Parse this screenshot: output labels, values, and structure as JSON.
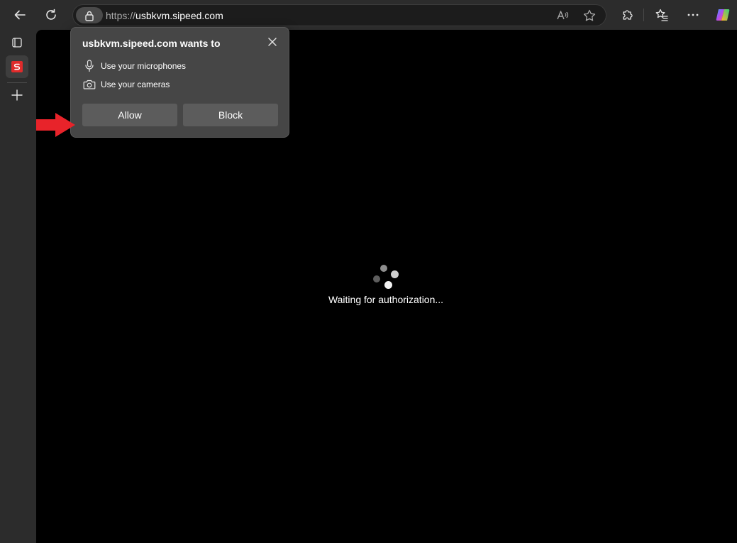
{
  "browser": {
    "url": {
      "scheme": "https://",
      "host": "usbkvm.sipeed.com"
    }
  },
  "permission_prompt": {
    "title": "usbkvm.sipeed.com wants to",
    "permissions": [
      {
        "icon": "microphone-icon",
        "label": "Use your microphones"
      },
      {
        "icon": "camera-icon",
        "label": "Use your cameras"
      }
    ],
    "allow_label": "Allow",
    "block_label": "Block"
  },
  "page": {
    "status_text": "Waiting for authorization..."
  },
  "colors": {
    "annotation_arrow": "#e8232a",
    "tab_icon": "#e02b2b"
  }
}
